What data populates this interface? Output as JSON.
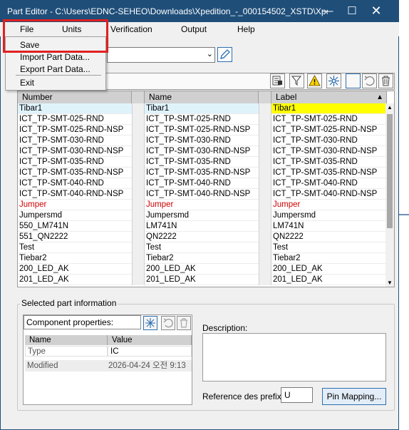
{
  "window": {
    "title": "Part Editor - C:\\Users\\EDNC-SEHEO\\Downloads\\Xpedition_-_000154502_XSTD\\Xpediti..."
  },
  "menubar": {
    "items": [
      "File",
      "Units",
      "Verification",
      "Output",
      "Help"
    ]
  },
  "file_menu": {
    "items": [
      "Save",
      "Import Part Data...",
      "Export Part Data...",
      "Exit"
    ]
  },
  "grid": {
    "columns": [
      "Number",
      "Name",
      "Label"
    ],
    "sort_indicator": "▲",
    "rows": [
      {
        "number": "Tibar1",
        "name": "Tibar1",
        "label": "Tibar1",
        "selected": true
      },
      {
        "number": "ICT_TP-SMT-025-RND",
        "name": "ICT_TP-SMT-025-RND",
        "label": "ICT_TP-SMT-025-RND"
      },
      {
        "number": "ICT_TP-SMT-025-RND-NSP",
        "name": "ICT_TP-SMT-025-RND-NSP",
        "label": "ICT_TP-SMT-025-RND-NSP"
      },
      {
        "number": "ICT_TP-SMT-030-RND",
        "name": "ICT_TP-SMT-030-RND",
        "label": "ICT_TP-SMT-030-RND"
      },
      {
        "number": "ICT_TP-SMT-030-RND-NSP",
        "name": "ICT_TP-SMT-030-RND-NSP",
        "label": "ICT_TP-SMT-030-RND-NSP"
      },
      {
        "number": "ICT_TP-SMT-035-RND",
        "name": "ICT_TP-SMT-035-RND",
        "label": "ICT_TP-SMT-035-RND"
      },
      {
        "number": "ICT_TP-SMT-035-RND-NSP",
        "name": "ICT_TP-SMT-035-RND-NSP",
        "label": "ICT_TP-SMT-035-RND-NSP"
      },
      {
        "number": "ICT_TP-SMT-040-RND",
        "name": "ICT_TP-SMT-040-RND",
        "label": "ICT_TP-SMT-040-RND"
      },
      {
        "number": "ICT_TP-SMT-040-RND-NSP",
        "name": "ICT_TP-SMT-040-RND-NSP",
        "label": "ICT_TP-SMT-040-RND-NSP"
      },
      {
        "number": "Jumper",
        "name": "Jumper",
        "label": "Jumper",
        "red": true
      },
      {
        "number": "Jumpersmd",
        "name": "Jumpersmd",
        "label": "Jumpersmd"
      },
      {
        "number": "550_LM741N",
        "name": "LM741N",
        "label": "LM741N"
      },
      {
        "number": "551_QN2222",
        "name": "QN2222",
        "label": "QN2222"
      },
      {
        "number": "Test",
        "name": "Test",
        "label": "Test"
      },
      {
        "number": "Tiebar2",
        "name": "Tiebar2",
        "label": "Tiebar2"
      },
      {
        "number": "200_LED_AK",
        "name": "200_LED_AK",
        "label": "200_LED_AK"
      },
      {
        "number": "201_LED_AK",
        "name": "201_LED_AK",
        "label": "201_LED_AK"
      }
    ]
  },
  "selected_part": {
    "group_label": "Selected part information",
    "component_properties_label": "Component properties:",
    "table_headers": [
      "Name",
      "Value"
    ],
    "type_name": "Type",
    "type_value": "IC",
    "modified_name": "Modified",
    "modified_value": "2026-04-24 오전 9:13",
    "description_label": "Description:",
    "reference_prefix_label": "Reference des prefix:",
    "reference_prefix_value": "U",
    "pin_mapping_label": "Pin Mapping..."
  },
  "colors": {
    "titlebar": "#1f4e79",
    "highlight_box": "#e02020",
    "selected_label": "#ffff00",
    "jumper_text": "#d00000"
  }
}
